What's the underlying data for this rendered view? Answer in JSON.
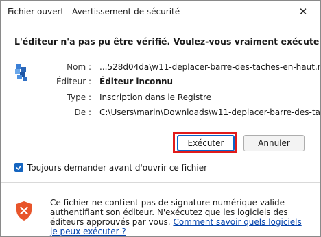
{
  "window": {
    "title": "Fichier ouvert - Avertissement de sécurité",
    "close_glyph": "✕"
  },
  "question": "L'éditeur n'a pas pu être vérifié. Voulez-vous vraiment exécuter ce logiciel ?",
  "details": {
    "name_label": "Nom :",
    "name_value": "...528d04da\\w11-deplacer-barre-des-taches-en-haut.reg",
    "publisher_label": "Éditeur :",
    "publisher_value": "Éditeur inconnu",
    "type_label": "Type :",
    "type_value": "Inscription dans le Registre",
    "from_label": "De :",
    "from_value": "C:\\Users\\marin\\Downloads\\w11-deplacer-barre-des-ta..."
  },
  "buttons": {
    "run": "Exécuter",
    "cancel": "Annuler"
  },
  "checkbox": {
    "label": "Toujours demander avant d'ouvrir ce fichier",
    "checked": true
  },
  "warning": {
    "text": "Ce fichier ne contient pas de signature numérique valide authentifiant son éditeur. N'exécutez que les logiciels des éditeurs approuvés par vous.",
    "link": "Comment savoir quels logiciels je peux exécuter ?"
  },
  "colors": {
    "accent": "#1565c0",
    "highlight_border": "#e11b1b",
    "shield": "#e8552b",
    "link": "#0645ad"
  },
  "icons": {
    "file": "registry-file-icon",
    "shield": "security-shield-icon",
    "check": "checkmark-icon",
    "close": "close-icon"
  }
}
